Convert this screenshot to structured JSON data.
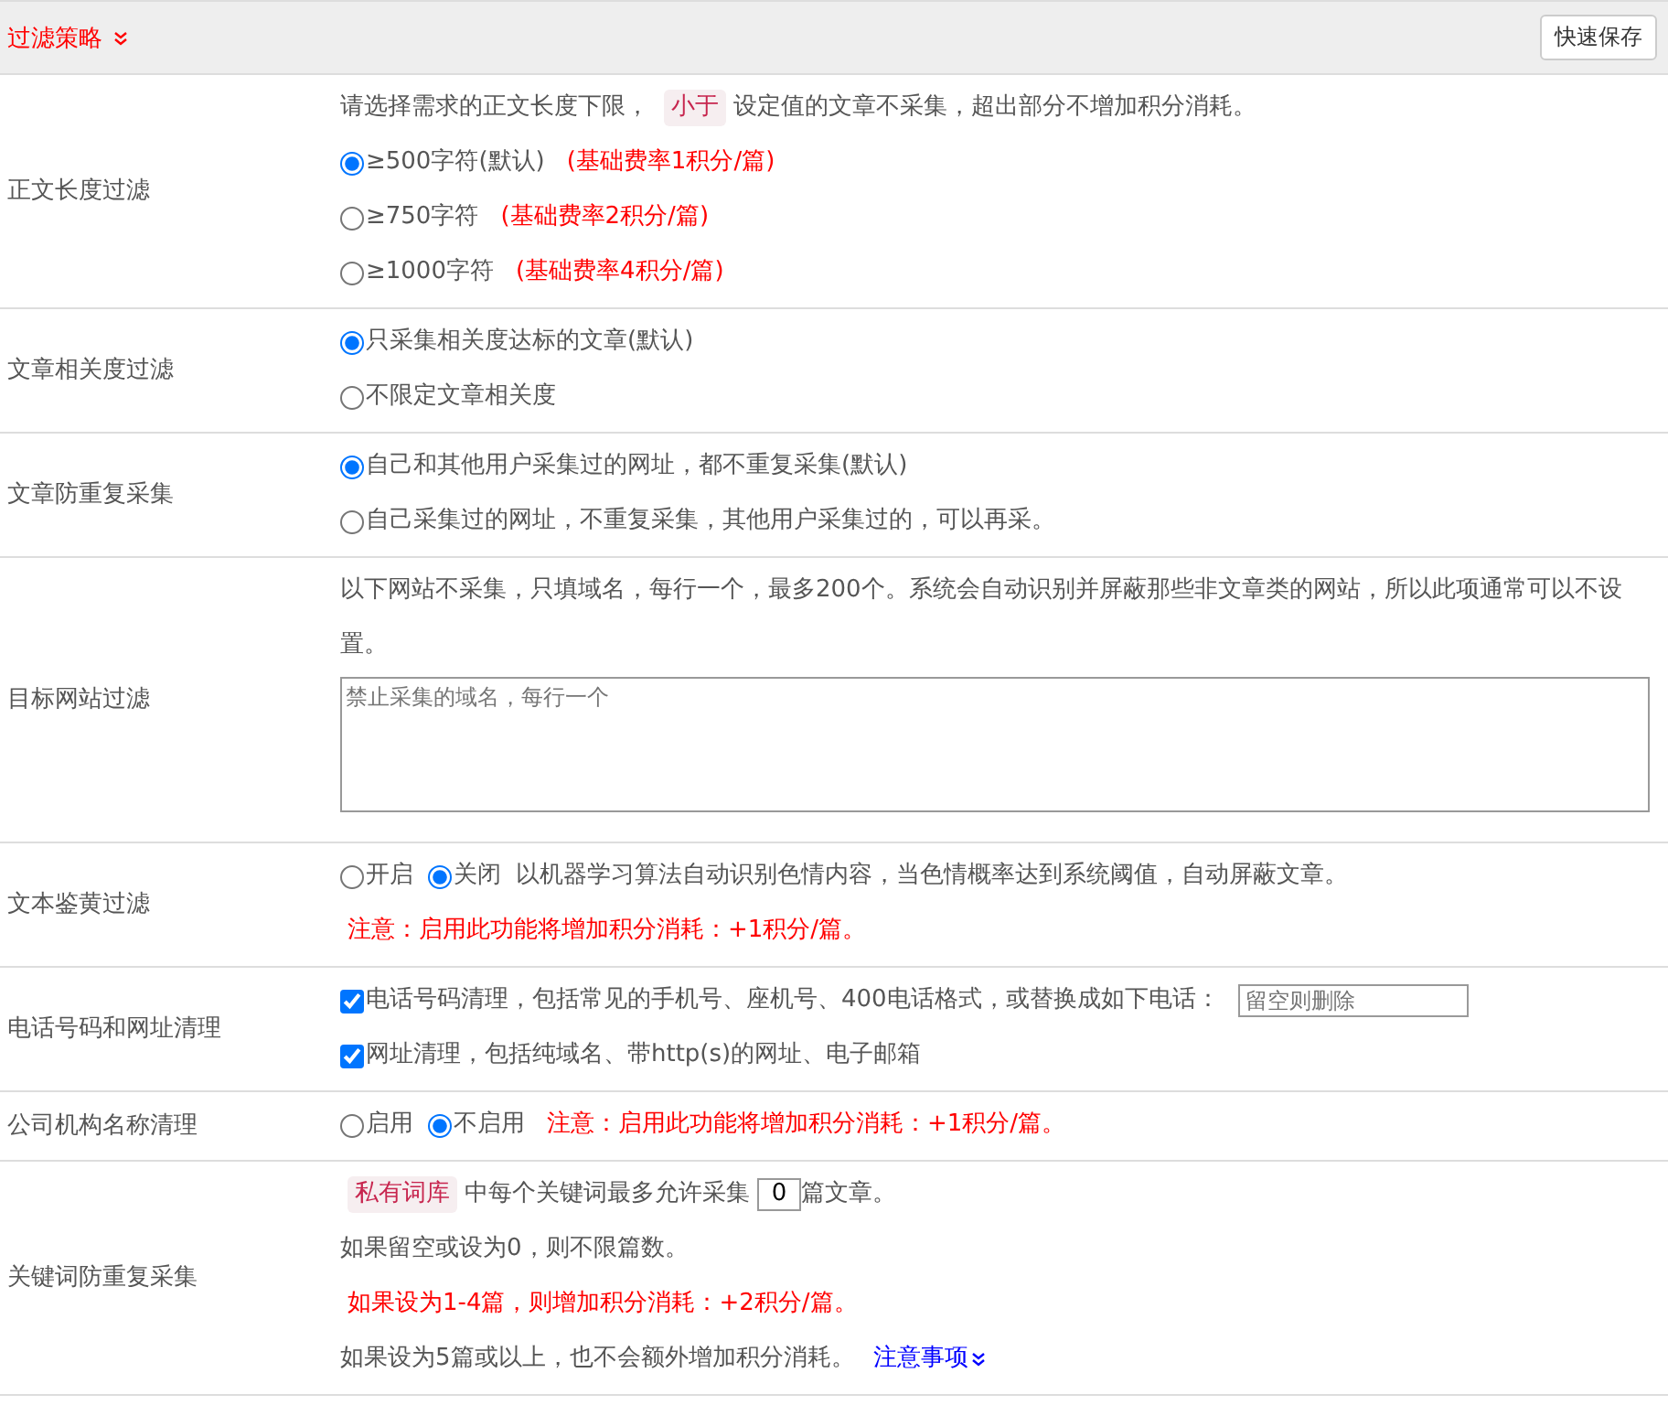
{
  "header": {
    "title": "过滤策略",
    "save_button": "快速保存"
  },
  "rows": [
    {
      "label": "正文长度过滤",
      "lines": [
        [
          {
            "kind": "text",
            "text": "请选择需求的正文长度下限，"
          },
          {
            "kind": "tag",
            "text": "小于"
          },
          {
            "kind": "text",
            "text": "设定值的文章不采集，超出部分不增加积分消耗。"
          }
        ],
        [
          {
            "kind": "radio",
            "text": "≥500字符(默认)",
            "selected": true
          },
          {
            "kind": "note",
            "text": "(基础费率1积分/篇)"
          }
        ],
        [
          {
            "kind": "radio",
            "text": "≥750字符",
            "selected": false
          },
          {
            "kind": "note",
            "text": "(基础费率2积分/篇)"
          }
        ],
        [
          {
            "kind": "radio",
            "text": "≥1000字符",
            "selected": false
          },
          {
            "kind": "note",
            "text": "(基础费率4积分/篇)"
          }
        ]
      ]
    },
    {
      "label": "文章相关度过滤",
      "lines": [
        [
          {
            "kind": "radio",
            "text": "只采集相关度达标的文章(默认)",
            "selected": true
          }
        ],
        [
          {
            "kind": "radio",
            "text": "不限定文章相关度",
            "selected": false
          }
        ]
      ]
    },
    {
      "label": "文章防重复采集",
      "lines": [
        [
          {
            "kind": "radio",
            "text": "自己和其他用户采集过的网址，都不重复采集(默认)",
            "selected": true
          }
        ],
        [
          {
            "kind": "radio",
            "text": "自己采集过的网址，不重复采集，其他用户采集过的，可以再采。",
            "selected": false
          }
        ]
      ]
    },
    {
      "label": "目标网站过滤",
      "lines": [
        [
          {
            "kind": "text",
            "text": "以下网站不采集，只填域名，每行一个，最多200个。系统会自动识别并屏蔽那些非文章类的网站，所以此项通常可以不设置。"
          }
        ],
        [
          {
            "kind": "textarea",
            "placeholder": "禁止采集的域名，每行一个"
          }
        ]
      ]
    },
    {
      "label": "文本鉴黄过滤",
      "lines": [
        [
          {
            "kind": "radio",
            "text": "开启",
            "selected": false
          },
          {
            "kind": "radio",
            "text": "关闭",
            "selected": true
          },
          {
            "kind": "text",
            "text": "以机器学习算法自动识别色情内容，当色情概率达到系统阈值，自动屏蔽文章。"
          }
        ],
        [
          {
            "kind": "note",
            "text": "注意：启用此功能将增加积分消耗：+1积分/篇。"
          }
        ]
      ]
    },
    {
      "label": "电话号码和网址清理",
      "lines": [
        [
          {
            "kind": "checkbox",
            "text": "电话号码清理，包括常见的手机号、座机号、400电话格式，或替换成如下电话：",
            "checked": true
          },
          {
            "kind": "input",
            "placeholder": "留空则删除"
          }
        ],
        [
          {
            "kind": "checkbox",
            "text": "网址清理，包括纯域名、带http(s)的网址、电子邮箱",
            "checked": true
          }
        ]
      ]
    },
    {
      "label": "公司机构名称清理",
      "lines": [
        [
          {
            "kind": "radio",
            "text": "启用",
            "selected": false
          },
          {
            "kind": "radio",
            "text": "不启用",
            "selected": true
          },
          {
            "kind": "note",
            "text": "注意：启用此功能将增加积分消耗：+1积分/篇。"
          }
        ]
      ]
    },
    {
      "label": "关键词防重复采集",
      "lines": [
        [
          {
            "kind": "tag",
            "text": "私有词库"
          },
          {
            "kind": "text",
            "text": "中每个关键词最多允许采集"
          },
          {
            "kind": "input",
            "value": "0"
          },
          {
            "kind": "text",
            "text": "篇文章。"
          }
        ],
        [
          {
            "kind": "text",
            "text": "如果留空或设为0，则不限篇数。"
          }
        ],
        [
          {
            "kind": "note",
            "text": "如果设为1-4篇，则增加积分消耗：+2积分/篇。"
          }
        ],
        [
          {
            "kind": "text",
            "text": "如果设为5篇或以上，也不会额外增加积分消耗。"
          },
          {
            "kind": "link",
            "text": "注意事项"
          }
        ]
      ]
    }
  ]
}
